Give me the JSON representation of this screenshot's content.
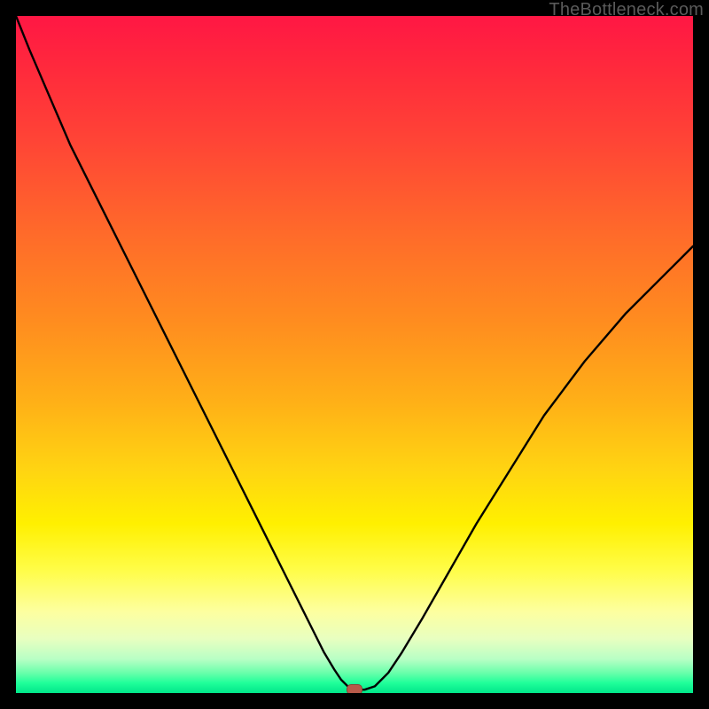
{
  "attribution": "TheBottleneck.com",
  "chart_data": {
    "type": "line",
    "title": "",
    "xlabel": "",
    "ylabel": "",
    "xlim": [
      0,
      100
    ],
    "ylim": [
      0,
      100
    ],
    "x": [
      0,
      2,
      5,
      8,
      12,
      16,
      20,
      24,
      28,
      32,
      35,
      38,
      40,
      42,
      44,
      45.5,
      47,
      48,
      49,
      50,
      51.5,
      53,
      55,
      57,
      60,
      64,
      68,
      73,
      78,
      84,
      90,
      96,
      100
    ],
    "values": [
      100,
      95,
      88,
      81,
      73,
      65,
      57,
      49,
      41,
      33,
      27,
      21,
      17,
      13,
      9,
      6,
      3.5,
      2,
      1,
      0.5,
      0.5,
      1,
      3,
      6,
      11,
      18,
      25,
      33,
      41,
      49,
      56,
      62,
      66
    ],
    "marker": {
      "x": 50,
      "y": 0.5
    },
    "background_gradient": {
      "top_color": "#ff1744",
      "middle_color": "#ffd412",
      "bottom_color": "#00e68a"
    }
  }
}
